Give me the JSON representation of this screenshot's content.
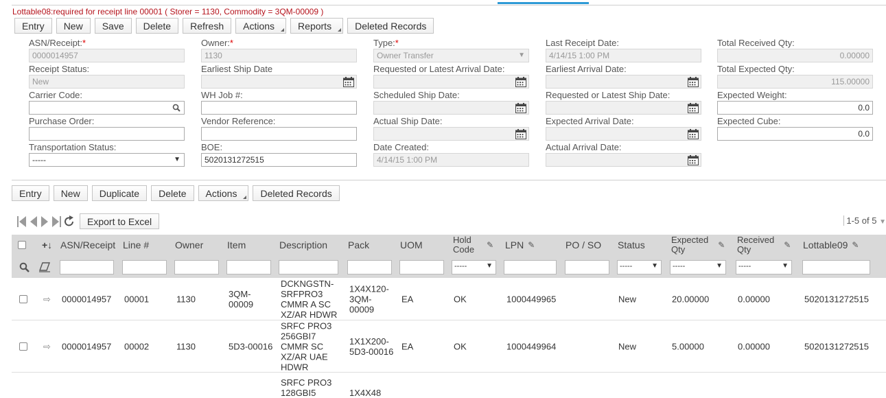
{
  "error": "Lottable08:required for receipt line 00001 ( Storer = 1130, Commodity = 3QM-00009 )",
  "toolbar_top": [
    "Entry",
    "New",
    "Save",
    "Delete",
    "Refresh",
    "Actions",
    "Reports",
    "Deleted Records"
  ],
  "form": {
    "asn_label": "ASN/Receipt:",
    "asn_value": "0000014957",
    "owner_label": "Owner:",
    "owner_value": "1130",
    "type_label": "Type:",
    "type_value": "Owner Transfer",
    "last_receipt_label": "Last Receipt Date:",
    "last_receipt_value": "4/14/15 1:00 PM",
    "total_received_label": "Total Received Qty:",
    "total_received_value": "0.00000",
    "receipt_status_label": "Receipt Status:",
    "receipt_status_value": "New",
    "earliest_ship_label": "Earliest Ship Date",
    "earliest_ship_value": "",
    "req_arrival_label": "Requested or Latest Arrival Date:",
    "req_arrival_value": "",
    "earliest_arrival_label": "Earliest Arrival Date:",
    "earliest_arrival_value": "",
    "total_expected_label": "Total Expected Qty:",
    "total_expected_value": "115.00000",
    "carrier_label": "Carrier Code:",
    "carrier_value": "",
    "whjob_label": "WH Job #:",
    "whjob_value": "",
    "sched_ship_label": "Scheduled Ship Date:",
    "sched_ship_value": "",
    "req_ship_label": "Requested or Latest Ship Date:",
    "req_ship_value": "",
    "exp_weight_label": "Expected Weight:",
    "exp_weight_value": "0.0",
    "po_label": "Purchase Order:",
    "po_value": "",
    "vendor_label": "Vendor Reference:",
    "vendor_value": "",
    "actual_ship_label": "Actual Ship Date:",
    "actual_ship_value": "",
    "exp_arrival_label": "Expected Arrival Date:",
    "exp_arrival_value": "",
    "exp_cube_label": "Expected Cube:",
    "exp_cube_value": "0.0",
    "transport_label": "Transportation Status:",
    "transport_value": "-----",
    "boe_label": "BOE:",
    "boe_value": "5020131272515",
    "created_label": "Date Created:",
    "created_value": "4/14/15 1:00 PM",
    "actual_arrival_label": "Actual Arrival Date:",
    "actual_arrival_value": ""
  },
  "toolbar_detail": [
    "Entry",
    "New",
    "Duplicate",
    "Delete",
    "Actions",
    "Deleted Records"
  ],
  "export_label": "Export to Excel",
  "page_count": "1-5 of 5",
  "columns": {
    "asn": "ASN/Receipt",
    "line": "Line #",
    "owner": "Owner",
    "item": "Item",
    "desc": "Description",
    "pack": "Pack",
    "uom": "UOM",
    "hold1": "Hold",
    "hold2": "Code",
    "lpn": "LPN",
    "poso": "PO / SO",
    "status": "Status",
    "exp1": "Expected",
    "exp2": "Qty",
    "rec1": "Received",
    "rec2": "Qty",
    "lot": "Lottable09"
  },
  "filter_select": "-----",
  "rows": [
    {
      "asn": "0000014957",
      "line": "00001",
      "owner": "1130",
      "item": "3QM-\n00009",
      "desc": "DCKNGSTN-\nSRFPRO3\nCMMR A SC\nXZ/AR HDWR",
      "pack": "1X4X120-\n3QM-\n00009",
      "uom": "EA",
      "hold": "OK",
      "lpn": "1000449965",
      "poso": "",
      "status": "New",
      "exp": "20.00000",
      "rec": "0.00000",
      "lot": "5020131272515"
    },
    {
      "asn": "0000014957",
      "line": "00002",
      "owner": "1130",
      "item": "5D3-00016",
      "desc": "SRFC PRO3\n256GBI7\nCMMR SC\nXZ/AR UAE\nHDWR",
      "pack": "1X1X200-\n5D3-00016",
      "uom": "EA",
      "hold": "OK",
      "lpn": "1000449964",
      "poso": "",
      "status": "New",
      "exp": "5.00000",
      "rec": "0.00000",
      "lot": "5020131272515"
    },
    {
      "desc": "SRFC PRO3\n128GBI5",
      "pack": "1X4X48"
    }
  ]
}
